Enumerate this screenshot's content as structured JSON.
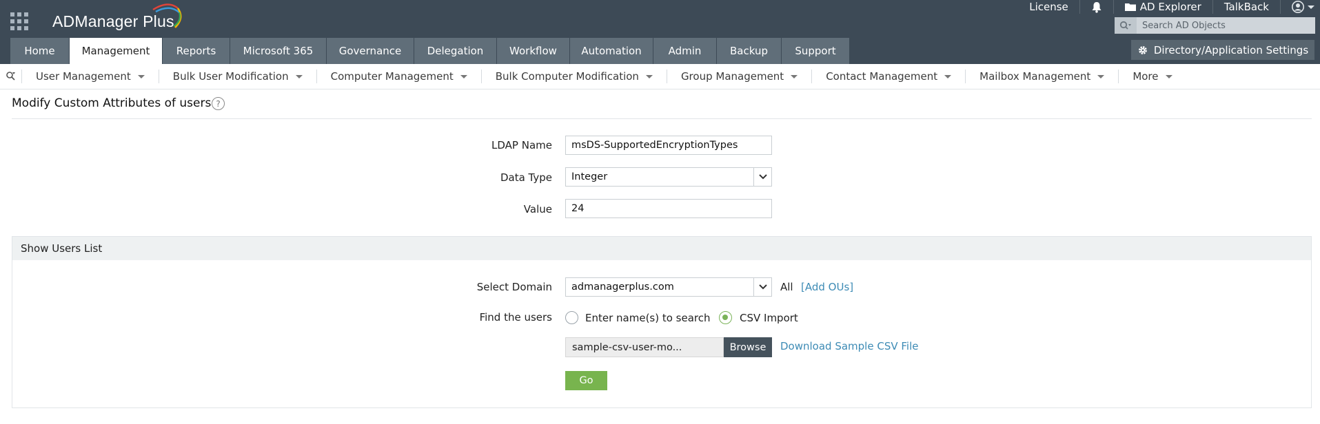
{
  "app": {
    "title": "ADManager Plus"
  },
  "top_links": {
    "license": "License",
    "ad_explorer": "AD Explorer",
    "talkback": "TalkBack"
  },
  "search": {
    "placeholder": "Search AD Objects"
  },
  "tabs": [
    {
      "label": "Home"
    },
    {
      "label": "Management"
    },
    {
      "label": "Reports"
    },
    {
      "label": "Microsoft 365"
    },
    {
      "label": "Governance"
    },
    {
      "label": "Delegation"
    },
    {
      "label": "Workflow"
    },
    {
      "label": "Automation"
    },
    {
      "label": "Admin"
    },
    {
      "label": "Backup"
    },
    {
      "label": "Support"
    }
  ],
  "active_tab": "Management",
  "settings_button": "Directory/Application Settings",
  "subnav": [
    {
      "label": "User Management"
    },
    {
      "label": "Bulk User Modification"
    },
    {
      "label": "Computer Management"
    },
    {
      "label": "Bulk Computer Modification"
    },
    {
      "label": "Group Management"
    },
    {
      "label": "Contact Management"
    },
    {
      "label": "Mailbox Management"
    },
    {
      "label": "More"
    }
  ],
  "page": {
    "title": "Modify Custom Attributes of users",
    "help": "?"
  },
  "form": {
    "ldap_label": "LDAP Name",
    "ldap_value": "msDS-SupportedEncryptionTypes",
    "datatype_label": "Data Type",
    "datatype_value": "Integer",
    "value_label": "Value",
    "value_value": "24"
  },
  "users_panel": {
    "title": "Show Users List",
    "domain_label": "Select Domain",
    "domain_value": "admanagerplus.com",
    "all_label": "All",
    "add_ous": "[Add OUs]",
    "find_label": "Find the users",
    "option_names": "Enter name(s) to search",
    "option_csv": "CSV Import",
    "selected_option": "CSV Import",
    "file_name": "sample-csv-user-mo...",
    "browse": "Browse",
    "download_sample": "Download Sample CSV File",
    "go": "Go"
  },
  "colors": {
    "header_bg": "#3d4a56",
    "tab_bg": "#606e79",
    "accent_green": "#78b44e",
    "link_blue": "#3d8bb5"
  }
}
